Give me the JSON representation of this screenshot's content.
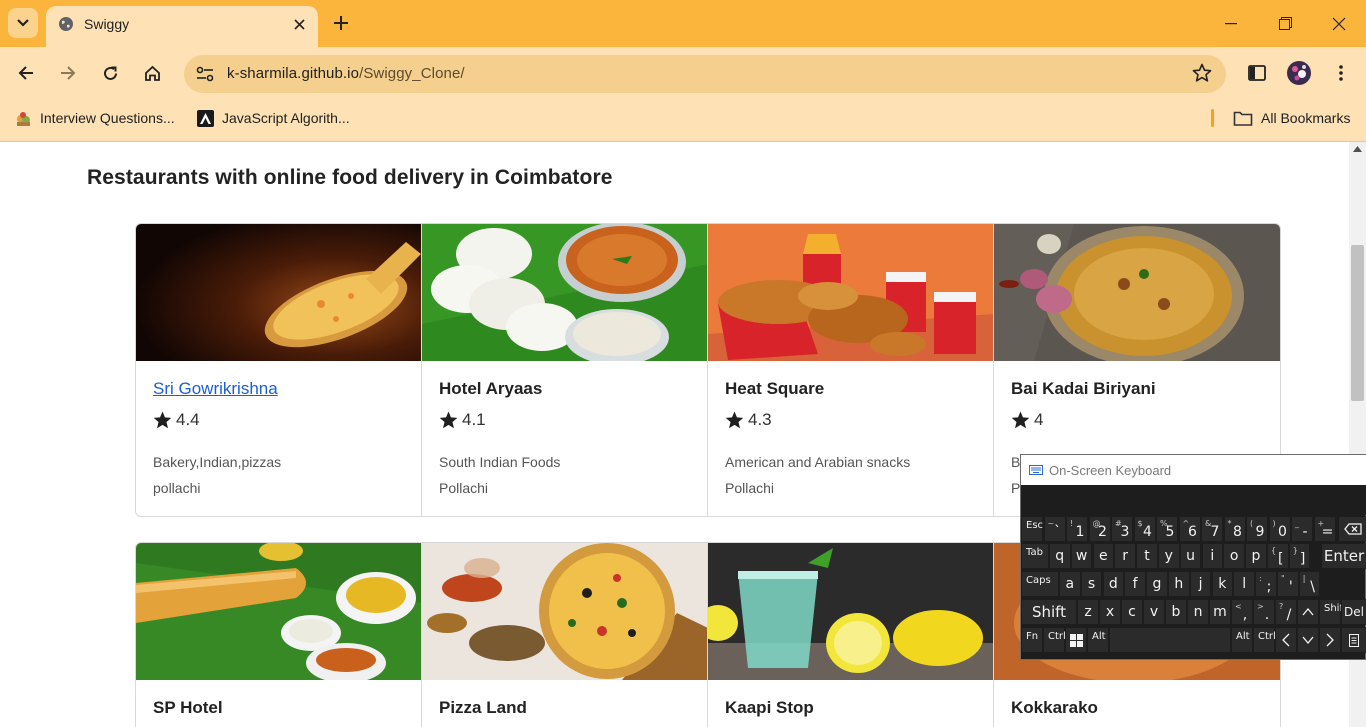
{
  "browser": {
    "tab_title": "Swiggy",
    "url_host": "k-sharmila.github.io",
    "url_path": "/Swiggy_Clone/",
    "bookmarks": [
      {
        "label": "Interview Questions..."
      },
      {
        "label": "JavaScript Algorith..."
      }
    ],
    "all_bookmarks_label": "All Bookmarks"
  },
  "page": {
    "heading": "Restaurants with online food delivery in Coimbatore",
    "restaurants_row1": [
      {
        "name": "Sri Gowrikrishna",
        "rating": "4.4",
        "cuisine": "Bakery,Indian,pizzas",
        "location": "pollachi",
        "image": "pizza-photo"
      },
      {
        "name": "Hotel Aryaas",
        "rating": "4.1",
        "cuisine": "South Indian Foods",
        "location": "Pollachi",
        "image": "idli-photo"
      },
      {
        "name": "Heat Square",
        "rating": "4.3",
        "cuisine": "American and Arabian snacks",
        "location": "Pollachi",
        "image": "fried-chicken-photo"
      },
      {
        "name": "Bai Kadai Biriyani",
        "rating": "4",
        "cuisine": "Bi",
        "location": "P",
        "image": "biriyani-photo"
      }
    ],
    "restaurants_row2": [
      {
        "name": "SP Hotel",
        "image": "dosa-photo"
      },
      {
        "name": "Pizza Land",
        "image": "pizza-spices-photo"
      },
      {
        "name": "Kaapi Stop",
        "image": "lemon-drink-photo"
      },
      {
        "name": "Kokkarako",
        "image": "chicken-photo"
      }
    ]
  },
  "osk": {
    "title": "On-Screen Keyboard",
    "row1": [
      "Esc",
      "~`",
      "!1",
      "@2",
      "#3",
      "$4",
      "%5",
      "^6",
      "&7",
      "*8",
      "(9",
      ")0",
      "_-",
      "+="
    ],
    "row2": [
      "Tab",
      "q",
      "w",
      "e",
      "r",
      "t",
      "y",
      "u",
      "i",
      "o",
      "p",
      "{[",
      "}]",
      "Enter"
    ],
    "row3": [
      "Caps",
      "a",
      "s",
      "d",
      "f",
      "g",
      "h",
      "j",
      "k",
      "l",
      ":;",
      "\"'",
      "|\\"
    ],
    "row4": [
      "Shift",
      "z",
      "x",
      "c",
      "v",
      "b",
      "n",
      "m",
      "<,",
      ">.",
      "?/",
      "Shift",
      "Del"
    ],
    "row5": [
      "Fn",
      "Ctrl",
      "Alt",
      "Alt",
      "Ctrl"
    ]
  },
  "colors": {
    "tabbar": "#fbb53c",
    "toolbar": "#fee2b5",
    "link": "#1a5fd6"
  }
}
